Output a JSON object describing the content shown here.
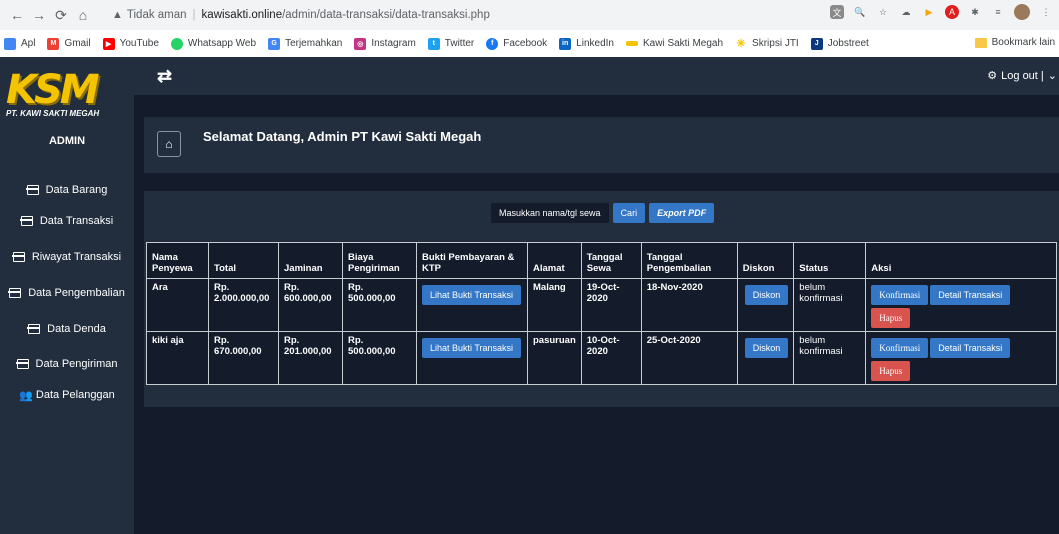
{
  "browser": {
    "security_label": "Tidak aman",
    "host": "kawisakti.online",
    "path": "/admin/data-transaksi/data-transaksi.php",
    "bookmarks": [
      {
        "label": "Apl",
        "color": "#4285f4"
      },
      {
        "label": "Gmail",
        "color": "#ea4335"
      },
      {
        "label": "YouTube",
        "color": "#ff0000"
      },
      {
        "label": "Whatsapp Web",
        "color": "#25d366"
      },
      {
        "label": "Terjemahkan",
        "color": "#4285f4"
      },
      {
        "label": "Instagram",
        "color": "#c13584"
      },
      {
        "label": "Twitter",
        "color": "#1da1f2"
      },
      {
        "label": "Facebook",
        "color": "#1877f2"
      },
      {
        "label": "LinkedIn",
        "color": "#0a66c2"
      },
      {
        "label": "Kawi Sakti Megah",
        "color": "#f5c400"
      },
      {
        "label": "Skripsi JTI",
        "color": "#f5c400"
      },
      {
        "label": "Jobstreet",
        "color": "#0d3880"
      }
    ],
    "bookmark_folder": "Bookmark lain"
  },
  "sidebar": {
    "logo_text": "KSM",
    "logo_subtitle": "PT. KAWI SAKTI MEGAH",
    "admin_label": "ADMIN",
    "items": [
      {
        "label": "Data Barang"
      },
      {
        "label": "Data Transaksi"
      },
      {
        "label": "Riwayat Transaksi"
      },
      {
        "label": "Data Pengembalian"
      },
      {
        "label": "Data Denda"
      },
      {
        "label": "Data Pengiriman"
      },
      {
        "label": "Data Pelanggan"
      }
    ]
  },
  "header": {
    "logout_label": "Log out |"
  },
  "welcome": {
    "text": "Selamat Datang, Admin PT Kawi Sakti Megah"
  },
  "search": {
    "label": "Masukkan nama/tgl sewa",
    "cari_label": "Cari",
    "export_label": "Export PDF"
  },
  "table": {
    "headers": [
      "Nama Penyewa",
      "Total",
      "Jaminan",
      "Biaya Pengiriman",
      "Bukti Pembayaran & KTP",
      "Alamat",
      "Tanggal Sewa",
      "Tanggal Pengembalian",
      "Diskon",
      "Status",
      "Aksi"
    ],
    "rows": [
      {
        "nama": "Ara",
        "total": "Rp. 2.000.000,00",
        "jaminan": "Rp. 600.000,00",
        "biaya": "Rp. 500.000,00",
        "bukti_btn": "Lihat Bukti Transaksi",
        "alamat": "Malang",
        "tgl_sewa": "19-Oct-2020",
        "tgl_kembali": "18-Nov-2020",
        "diskon_btn": "Diskon",
        "status": "belum konfirmasi",
        "konfirmasi_btn": "Konfirmasi",
        "detail_btn": "Detail Transaksi",
        "hapus_btn": "Hapus"
      },
      {
        "nama": "kiki aja",
        "total": "Rp. 670.000,00",
        "jaminan": "Rp. 201.000,00",
        "biaya": "Rp. 500.000,00",
        "bukti_btn": "Lihat Bukti Transaksi",
        "alamat": "pasuruan",
        "tgl_sewa": "10-Oct-2020",
        "tgl_kembali": "25-Oct-2020",
        "diskon_btn": "Diskon",
        "status": "belum konfirmasi",
        "konfirmasi_btn": "Konfirmasi",
        "detail_btn": "Detail Transaksi",
        "hapus_btn": "Hapus"
      }
    ]
  }
}
